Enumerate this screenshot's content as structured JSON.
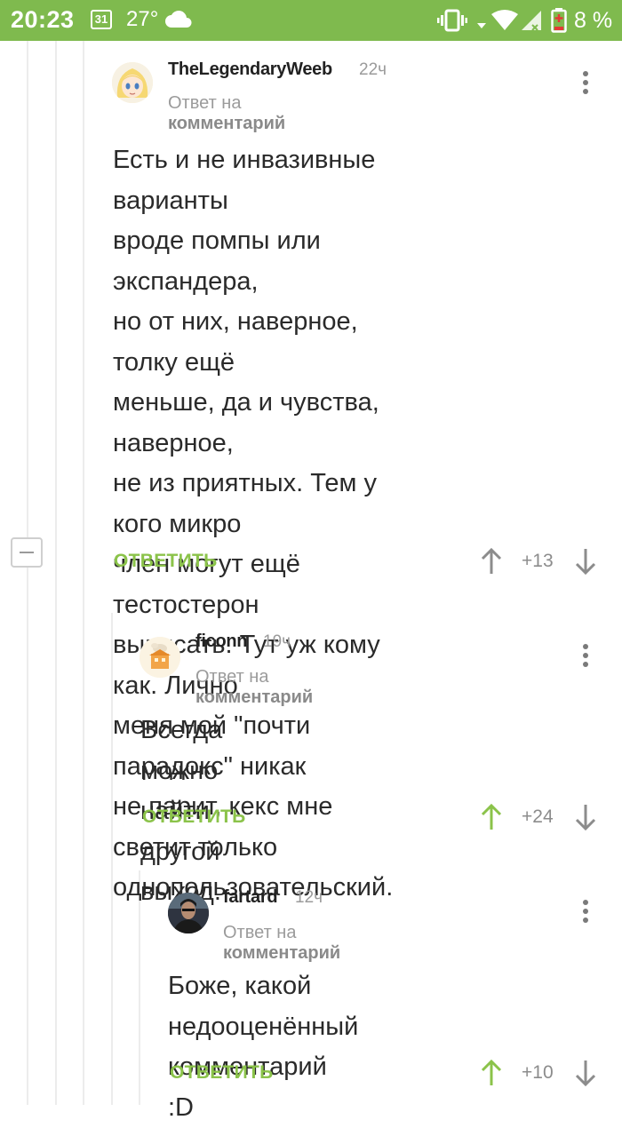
{
  "status_bar": {
    "time": "20:23",
    "calendar_day": "31",
    "temperature": "27°",
    "battery_percent": "8 %",
    "accent_color": "#7fba4e"
  },
  "comments": [
    {
      "author": "TheLegendaryWeeb",
      "time_ago": "22ч",
      "reply_prefix": "Ответ на",
      "reply_link": "комментарий",
      "body": [
        "Есть и не инвазивные варианты",
        "вроде помпы или экспандера,",
        "но от них, наверное, толку ещё",
        "меньше, да и чувства, наверное,",
        "не из приятных. Тем у кого микро",
        "член могут ещё тестостерон",
        "выписать. Тут уж кому как. Лично",
        "меня мой \"почти  парадокс\" никак",
        "не парит, кекс мне светит только",
        "однопользовательский."
      ],
      "reply_label": "ОТВЕТИТЬ",
      "score": "+13",
      "upvoted": false
    },
    {
      "author": "ficonn",
      "time_ago": "19ч",
      "reply_prefix": "Ответ на",
      "reply_link": "комментарий",
      "body": [
        "Всегда можно найти другой",
        "выход."
      ],
      "reply_label": "ОТВЕТИТЬ",
      "score": "+24",
      "upvoted": true
    },
    {
      "author": "fartard",
      "time_ago": "12ч",
      "reply_prefix": "Ответ на",
      "reply_link": "комментарий",
      "body": [
        "Боже, какой недооценённый",
        "комментарий :D"
      ],
      "reply_label": "ОТВЕТИТЬ",
      "score": "+10",
      "upvoted": true
    }
  ],
  "icons": {
    "upvote": "arrow-up-icon",
    "downvote": "arrow-down-icon",
    "menu": "more-vertical-icon",
    "collapse": "minus-icon"
  }
}
